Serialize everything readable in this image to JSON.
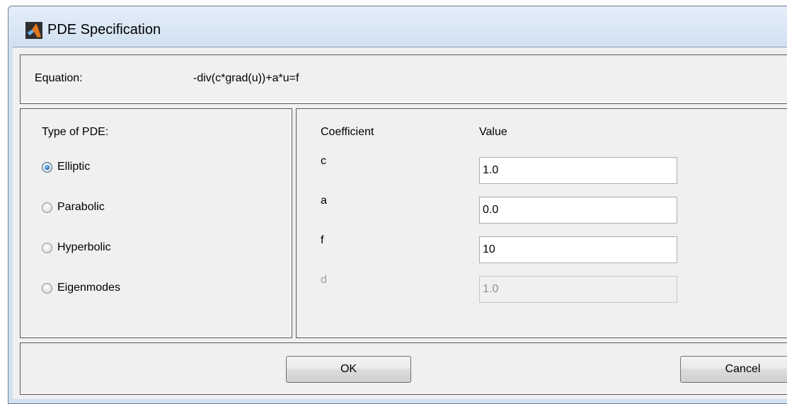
{
  "window": {
    "title": "PDE Specification",
    "icon": "matlab-logo-icon"
  },
  "equation": {
    "label": "Equation:",
    "value": "-div(c*grad(u))+a*u=f"
  },
  "pde_type": {
    "heading": "Type of PDE:",
    "options": [
      {
        "label": "Elliptic",
        "checked": true
      },
      {
        "label": "Parabolic",
        "checked": false
      },
      {
        "label": "Hyperbolic",
        "checked": false
      },
      {
        "label": "Eigenmodes",
        "checked": false
      }
    ]
  },
  "coefficients": {
    "col_coefficient": "Coefficient",
    "col_value": "Value",
    "rows": [
      {
        "name": "c",
        "value": "1.0",
        "enabled": true
      },
      {
        "name": "a",
        "value": "0.0",
        "enabled": true
      },
      {
        "name": "f",
        "value": "10",
        "enabled": true
      },
      {
        "name": "d",
        "value": "1.0",
        "enabled": false
      }
    ]
  },
  "buttons": {
    "ok": "OK",
    "cancel": "Cancel"
  }
}
